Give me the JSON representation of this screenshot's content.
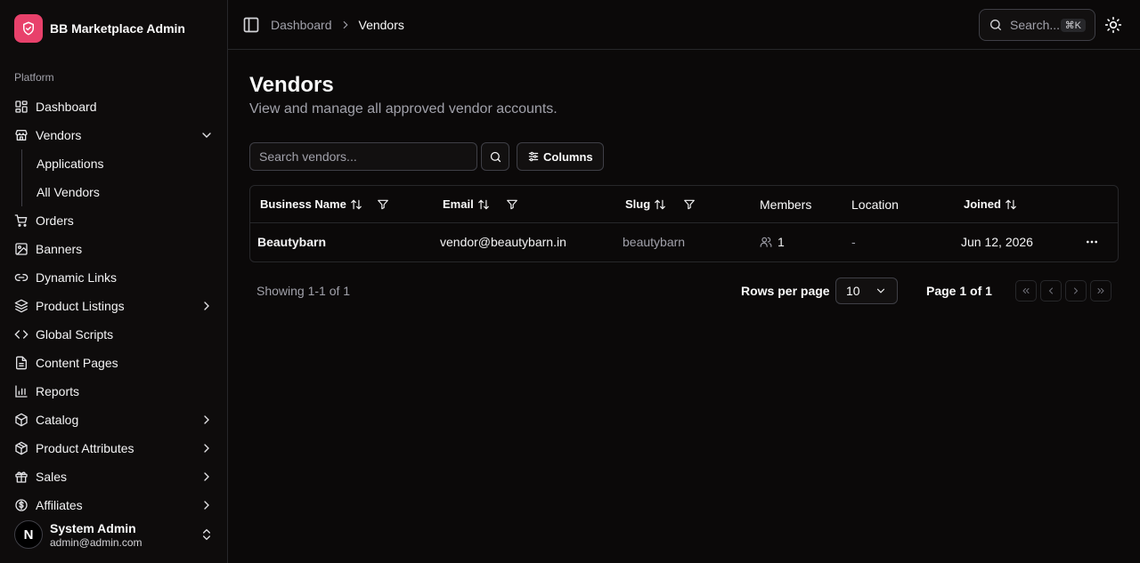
{
  "app": {
    "name": "BB Marketplace Admin"
  },
  "sidebar": {
    "section_label": "Platform",
    "items": [
      {
        "label": "Dashboard",
        "icon": "dashboard-icon"
      },
      {
        "label": "Vendors",
        "icon": "store-icon",
        "expanded": true,
        "children": [
          {
            "label": "Applications"
          },
          {
            "label": "All Vendors"
          }
        ]
      },
      {
        "label": "Orders",
        "icon": "cart-icon"
      },
      {
        "label": "Banners",
        "icon": "image-icon"
      },
      {
        "label": "Dynamic Links",
        "icon": "link-icon"
      },
      {
        "label": "Product Listings",
        "icon": "layers-icon"
      },
      {
        "label": "Global Scripts",
        "icon": "code-icon"
      },
      {
        "label": "Content Pages",
        "icon": "file-icon"
      },
      {
        "label": "Reports",
        "icon": "bar-chart-icon"
      },
      {
        "label": "Catalog",
        "icon": "package-icon"
      },
      {
        "label": "Product Attributes",
        "icon": "box-icon"
      },
      {
        "label": "Sales",
        "icon": "gift-icon"
      },
      {
        "label": "Affiliates",
        "icon": "dollar-icon"
      }
    ],
    "user": {
      "initial": "N",
      "name": "System Admin",
      "email": "admin@admin.com"
    }
  },
  "header": {
    "breadcrumb": [
      "Dashboard",
      "Vendors"
    ],
    "search_label": "Search...",
    "search_shortcut": "⌘K"
  },
  "page": {
    "title": "Vendors",
    "subtitle": "View and manage all approved vendor accounts."
  },
  "toolbar": {
    "search_placeholder": "Search vendors...",
    "columns_label": "Columns"
  },
  "table": {
    "columns": [
      "Business Name",
      "Email",
      "Slug",
      "Members",
      "Location",
      "Joined"
    ],
    "rows": [
      {
        "business_name": "Beautybarn",
        "email": "vendor@beautybarn.in",
        "slug": "beautybarn",
        "members": "1",
        "location": "-",
        "joined": "Jun 12, 2026"
      }
    ]
  },
  "pagination": {
    "showing": "Showing 1-1 of 1",
    "rows_per_page_label": "Rows per page",
    "rows_per_page": "10",
    "page_label": "Page 1 of 1"
  },
  "colors": {
    "accent": "#e8416b",
    "background": "#0b0909",
    "border": "#27272a",
    "muted_text": "#a1a1aa"
  }
}
